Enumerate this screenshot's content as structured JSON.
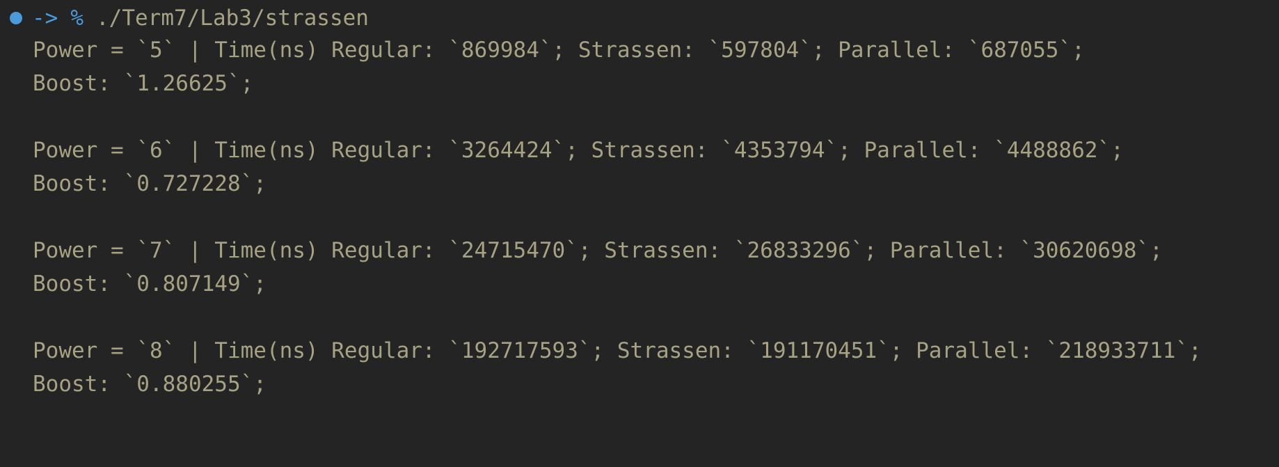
{
  "colors": {
    "background": "#242424",
    "text": "#a7a282",
    "prompt_accent": "#4a9bdc"
  },
  "prompt": {
    "status_icon": "dot-icon",
    "arrow": "->",
    "symbol": "%",
    "command": "./Term7/Lab3/strassen"
  },
  "output_lines": [
    "Power = `5` | Time(ns) Regular: `869984`; Strassen: `597804`; Parallel: `687055`;",
    "Boost: `1.26625`;",
    "",
    "Power = `6` | Time(ns) Regular: `3264424`; Strassen: `4353794`; Parallel: `4488862`;",
    "Boost: `0.727228`;",
    "",
    "Power = `7` | Time(ns) Regular: `24715470`; Strassen: `26833296`; Parallel: `30620698`;",
    "Boost: `0.807149`;",
    "",
    "Power = `8` | Time(ns) Regular: `192717593`; Strassen: `191170451`; Parallel: `218933711`;",
    "Boost: `0.880255`;"
  ]
}
